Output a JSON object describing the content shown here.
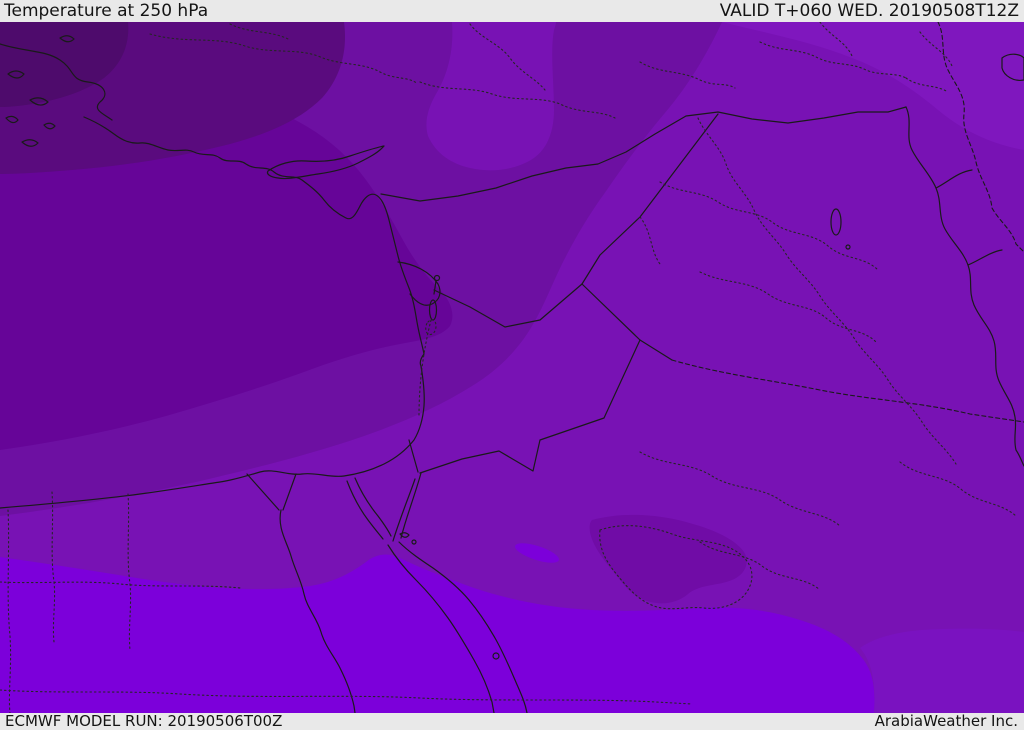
{
  "header": {
    "title": "Temperature at 250 hPa",
    "valid_label": "VALID T+060 WED. 20190508T12Z"
  },
  "footer": {
    "model_run": "ECMWF MODEL RUN: 20190506T00Z",
    "attribution": "ArabiaWeather Inc."
  },
  "map": {
    "region": "Middle East / Eastern Mediterranean",
    "colors": {
      "bar_bg": "#e9e9e9",
      "bar_text": "#141414",
      "base": "#7812B4",
      "dark1": "#6D10A2",
      "dark2": "#660598",
      "dark3": "#5A0B7E",
      "dark4": "#4E0B6C",
      "bright": "#7C00DA",
      "bright_muted": "#7A12C0",
      "light_ne": "#7F17BE",
      "blob_dark": "#700CA6",
      "line": "#1a1a1a",
      "line_dotted": "#262626"
    }
  }
}
